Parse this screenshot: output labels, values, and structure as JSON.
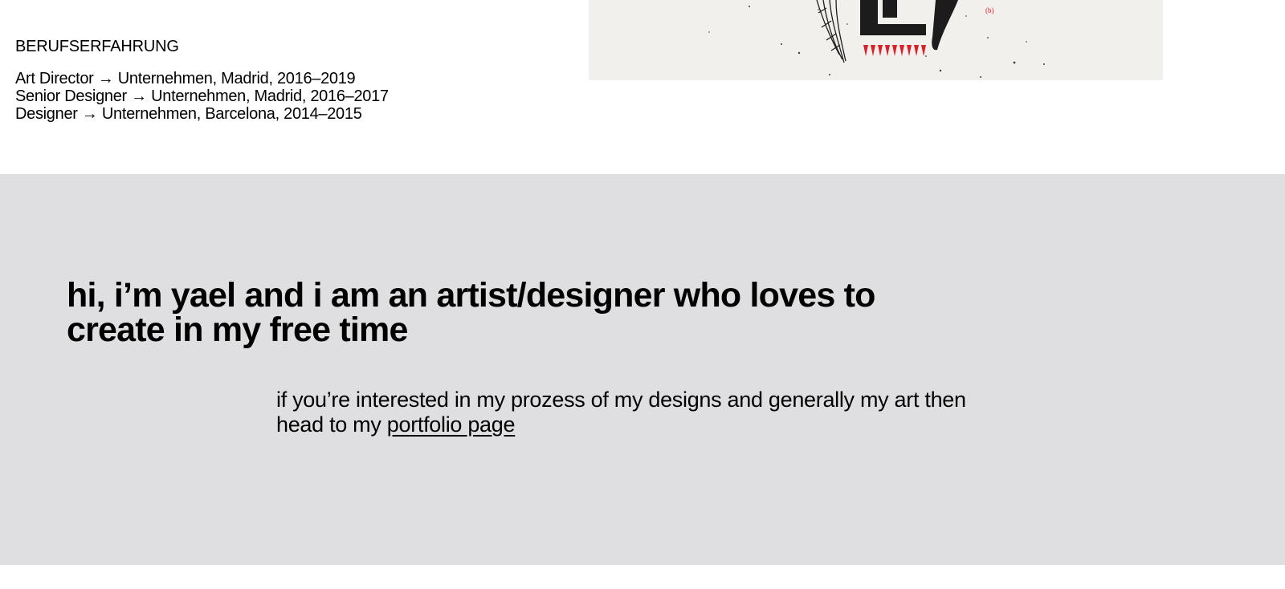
{
  "experience": {
    "heading": "BERUFSERFAHRUNG",
    "jobs": [
      "Art Director → Unternehmen, Madrid, 2016–2019",
      "Senior Designer → Unternehmen, Madrid, 2016–2017",
      "Designer → Unternehmen, Barcelona, 2014–2015"
    ]
  },
  "artwork": {
    "small_label": "(b)"
  },
  "intro": {
    "headline": "hi, i’m yael and i am an artist/designer who loves to create in my free time",
    "text": "if you’re interested in my prozess of my designs and generally my art then head to my",
    "link_label": "portfolio page"
  },
  "colors": {
    "intro_background": "#dfdfe1",
    "artwork_background": "#f2f0ec",
    "artwork_accent": "#d9202b"
  }
}
